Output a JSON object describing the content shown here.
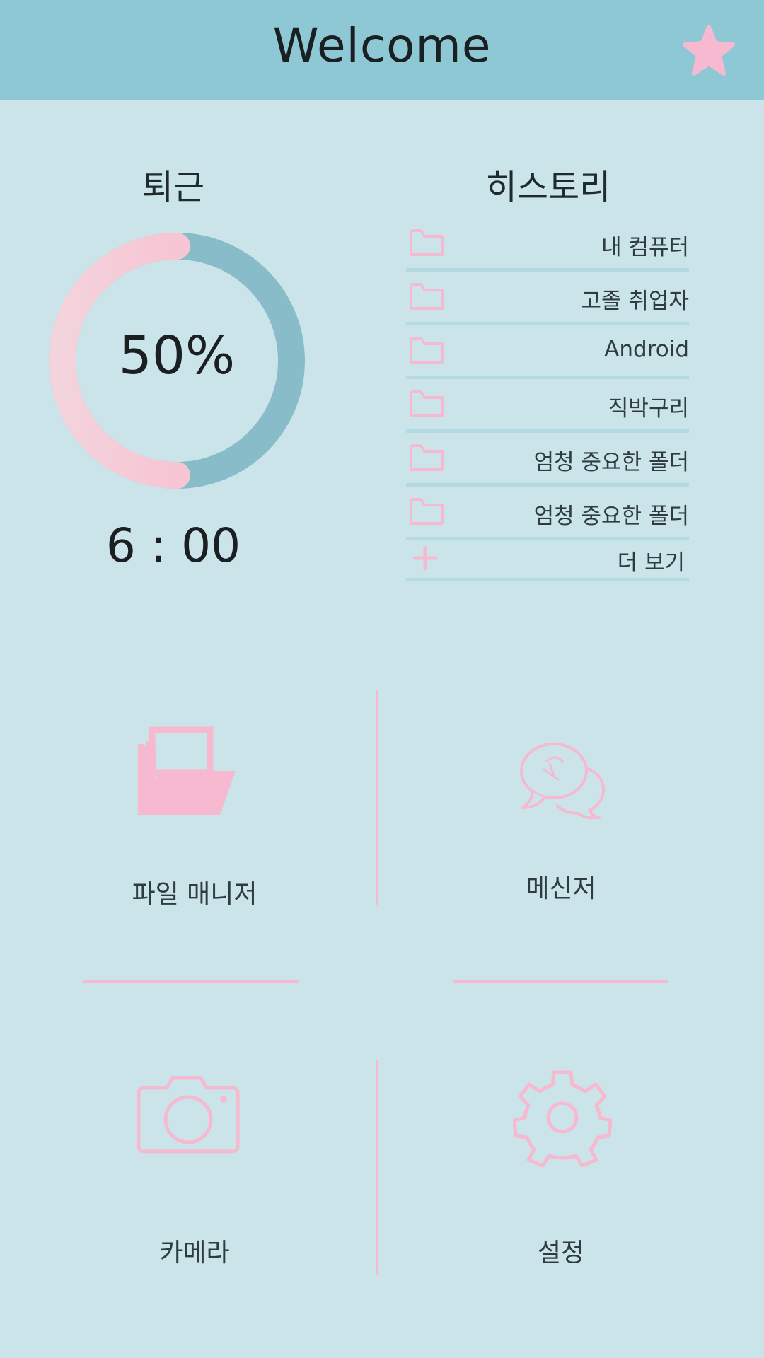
{
  "header": {
    "title": "Welcome",
    "favorite_icon": "star-icon"
  },
  "commute": {
    "title": "퇴근",
    "progress_text": "50%",
    "progress": 0.5,
    "time": "6 : 00"
  },
  "history": {
    "title": "히스토리",
    "items": [
      {
        "label": "내 컴퓨터",
        "icon": "folder-icon"
      },
      {
        "label": "고졸 취업자",
        "icon": "folder-icon"
      },
      {
        "label": "Android",
        "icon": "folder-icon"
      },
      {
        "label": "직박구리",
        "icon": "folder-icon"
      },
      {
        "label": "엄청 중요한 폴더",
        "icon": "folder-icon"
      },
      {
        "label": "엄청 중요한 폴더",
        "icon": "folder-icon"
      }
    ],
    "more_label": "더 보기"
  },
  "apps": [
    {
      "label": "파일 매니저",
      "icon": "file-manager-icon"
    },
    {
      "label": "메신저",
      "icon": "messenger-icon"
    },
    {
      "label": "카메라",
      "icon": "camera-icon"
    },
    {
      "label": "설정",
      "icon": "settings-icon"
    }
  ],
  "colors": {
    "header_bg": "#8ec8d4",
    "page_bg": "#cbe4e9",
    "accent_pink": "#f7b9cf",
    "ring_teal": "#88bcc8"
  }
}
